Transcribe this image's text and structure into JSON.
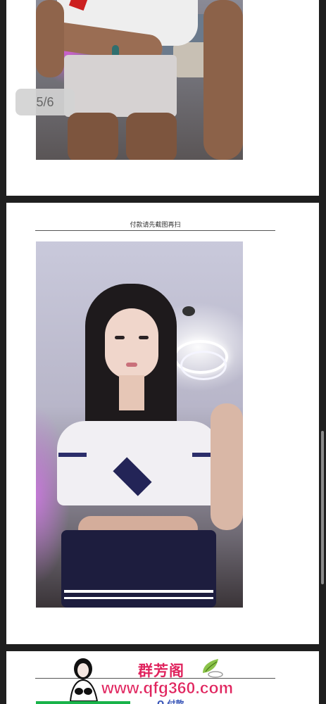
{
  "viewer": {
    "page_counter": "5/6"
  },
  "page2": {
    "header_text": "付款请先截图再扫"
  },
  "watermark": {
    "brand": "群芳阁",
    "url": "www.qfg360.com"
  },
  "page3": {
    "partial_text": "Q 付款"
  },
  "colors": {
    "background": "#1f1f1f",
    "page": "#ffffff",
    "watermark": "#e0245e",
    "green_bar": "#19b34a"
  },
  "icons": {
    "counter": "page-counter-badge",
    "watermark_avatar": "woman-silhouette-icon",
    "watermark_leaf": "leaf-teacup-icon"
  }
}
